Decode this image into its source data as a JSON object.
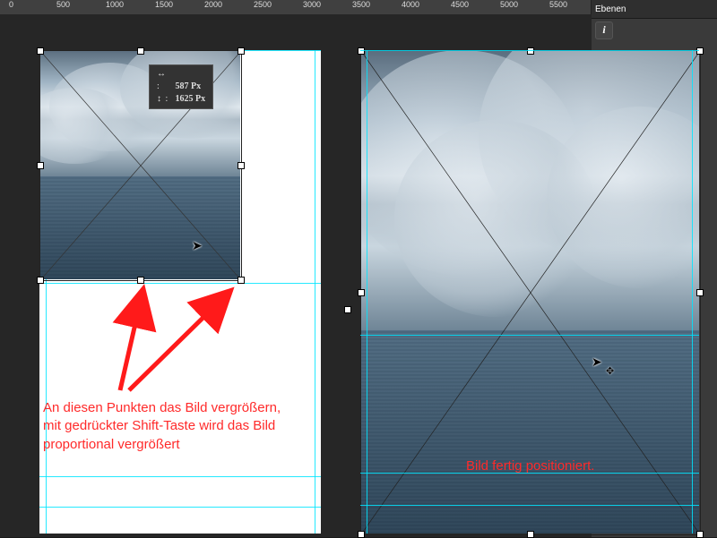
{
  "ruler": {
    "labels": [
      "0",
      "500",
      "1000",
      "1500",
      "2000",
      "2500",
      "3000",
      "3500",
      "4000",
      "4500",
      "5000",
      "5500"
    ]
  },
  "panel": {
    "tab1": "Ebenen",
    "tab2": ""
  },
  "size_tip": {
    "w_label": "↔ :",
    "w_value": "587 Px",
    "h_label": "↕ :",
    "h_value": "1625 Px"
  },
  "annA_l1": "An diesen Punkten das Bild vergrößern,",
  "annA_l2": "mit gedrückter Shift-Taste wird das Bild",
  "annA_l3": "proportional vergrößert",
  "annB": "Bild fertig positioniert.",
  "icon_info": "i"
}
